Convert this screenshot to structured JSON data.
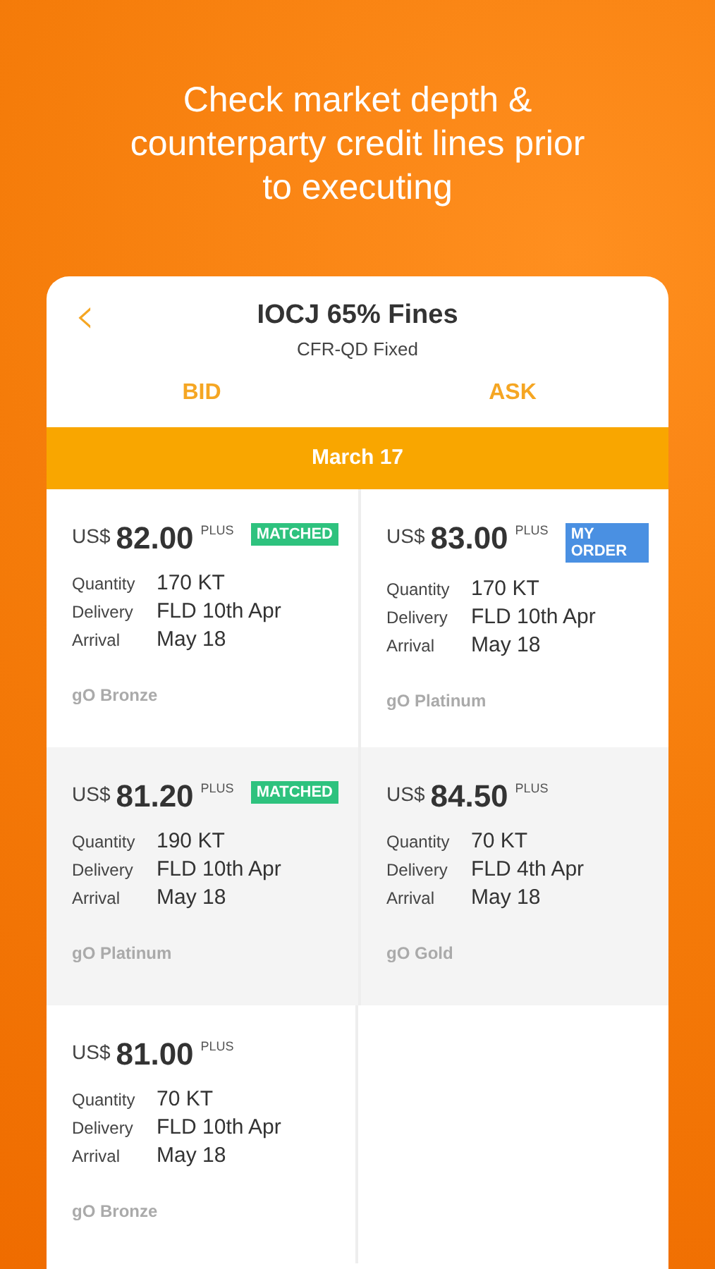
{
  "headline": "Check market depth & counterparty credit lines prior to executing",
  "card": {
    "back": "‹",
    "title": "IOCJ 65% Fines",
    "subtitle": "CFR-QD Fixed",
    "tabs": [
      {
        "label": "BID"
      },
      {
        "label": "ASK"
      }
    ],
    "date": "March 17",
    "rows": [
      {
        "cells": [
          {
            "currency": "US$",
            "price": "82.00",
            "suffix": "PLUS",
            "badge": {
              "kind": "matched",
              "label": "MATCHED"
            },
            "details": [
              {
                "label": "Quantity",
                "value": "170 KT"
              },
              {
                "label": "Delivery",
                "value": "FLD 10th Apr"
              },
              {
                "label": "Arrival",
                "value": "May 18"
              }
            ],
            "tier": "gO Bronze"
          },
          {
            "currency": "US$",
            "price": "83.00",
            "suffix": "PLUS",
            "badge": {
              "kind": "my_order",
              "label": "MY ORDER"
            },
            "details": [
              {
                "label": "Quantity",
                "value": "170 KT"
              },
              {
                "label": "Delivery",
                "value": "FLD 10th Apr"
              },
              {
                "label": "Arrival",
                "value": "May 18"
              }
            ],
            "tier": "gO Platinum"
          }
        ]
      },
      {
        "cells": [
          {
            "currency": "US$",
            "price": "81.20",
            "suffix": "PLUS",
            "badge": {
              "kind": "matched",
              "label": "MATCHED"
            },
            "details": [
              {
                "label": "Quantity",
                "value": "190 KT"
              },
              {
                "label": "Delivery",
                "value": "FLD 10th Apr"
              },
              {
                "label": "Arrival",
                "value": "May 18"
              }
            ],
            "tier": "gO Platinum"
          },
          {
            "currency": "US$",
            "price": "84.50",
            "suffix": "PLUS",
            "details": [
              {
                "label": "Quantity",
                "value": "70 KT"
              },
              {
                "label": "Delivery",
                "value": "FLD 4th Apr"
              },
              {
                "label": "Arrival",
                "value": "May 18"
              }
            ],
            "tier": "gO Gold"
          }
        ]
      },
      {
        "cells": [
          {
            "currency": "US$",
            "price": "81.00",
            "suffix": "PLUS",
            "details": [
              {
                "label": "Quantity",
                "value": "70 KT"
              },
              {
                "label": "Delivery",
                "value": "FLD 10th Apr"
              },
              {
                "label": "Arrival",
                "value": "May 18"
              }
            ],
            "tier": "gO Bronze"
          }
        ]
      }
    ]
  }
}
